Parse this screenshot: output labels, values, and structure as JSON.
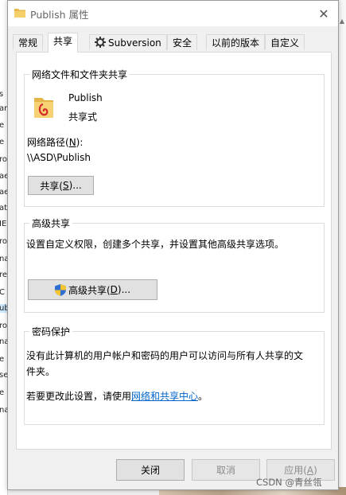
{
  "window": {
    "title": "Publish 属性",
    "close_icon": "close-icon"
  },
  "tabs": [
    {
      "label": "常规"
    },
    {
      "label": "共享"
    },
    {
      "label": "Subversion"
    },
    {
      "label": "安全"
    },
    {
      "label": "以前的版本"
    },
    {
      "label": "自定义"
    }
  ],
  "network_share": {
    "group_title": "网络文件和文件夹共享",
    "folder_name": "Publish",
    "folder_status": "共享式",
    "path_label_pre": "网络路径(",
    "path_label_key": "N",
    "path_label_post": "):",
    "path_value": "\\\\ASD\\Publish",
    "share_button_pre": "共享(",
    "share_button_key": "S",
    "share_button_post": ")..."
  },
  "advanced_share": {
    "group_title": "高级共享",
    "description": "设置自定义权限，创建多个共享，并设置其他高级共享选项。",
    "button_pre": "高级共享(",
    "button_key": "D",
    "button_post": ")..."
  },
  "password": {
    "group_title": "密码保护",
    "description_line1": "没有此计算机的用户帐户和密码的用户可以访问与所有人共享的文",
    "description_line2": "件夹。",
    "change_pre": "若要更改此设置，请使用",
    "change_link": "网络和共享中心",
    "change_post": "。"
  },
  "footer": {
    "close_label": "关闭",
    "cancel_label": "取消",
    "apply_pre": "应用(",
    "apply_key": "A",
    "apply_post": ")"
  },
  "background": {
    "left_fragments": [
      "s",
      "ar",
      "e",
      "e",
      "ro",
      "ae",
      "ae",
      "at",
      "IE",
      "ro",
      "na",
      "re",
      "C",
      "ub",
      "ro",
      "na",
      "e",
      "se",
      "e",
      "na"
    ],
    "watermark": "CSDN @青丝瓴"
  },
  "colors": {
    "link": "#0066cc",
    "group_border": "#dcdcdc",
    "button_face": "#e1e1e1"
  }
}
